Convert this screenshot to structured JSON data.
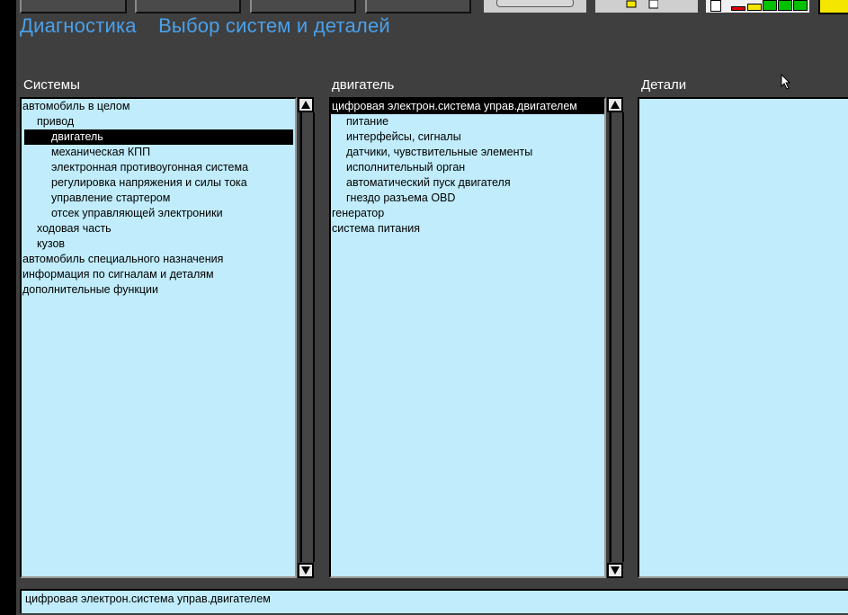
{
  "header": {
    "title_primary": "Диагностика",
    "title_secondary": "Выбор систем и деталей"
  },
  "columns": {
    "systems": {
      "title": "Системы",
      "items": [
        {
          "label": "автомобиль в целом",
          "level": 0,
          "selected": false
        },
        {
          "label": "привод",
          "level": 1,
          "selected": false
        },
        {
          "label": "двигатель",
          "level": 2,
          "selected": true
        },
        {
          "label": "механическая КПП",
          "level": 2,
          "selected": false
        },
        {
          "label": "электронная противоугонная система",
          "level": 2,
          "selected": false
        },
        {
          "label": "регулировка напряжения и силы тока",
          "level": 2,
          "selected": false
        },
        {
          "label": "управление стартером",
          "level": 2,
          "selected": false
        },
        {
          "label": "отсек управляющей электроники",
          "level": 2,
          "selected": false
        },
        {
          "label": "ходовая часть",
          "level": 1,
          "selected": false
        },
        {
          "label": "кузов",
          "level": 1,
          "selected": false
        },
        {
          "label": "автомобиль специального назначения",
          "level": 0,
          "selected": false
        },
        {
          "label": "информация по сигналам и деталям",
          "level": 0,
          "selected": false
        },
        {
          "label": "дополнительные функции",
          "level": 0,
          "selected": false
        }
      ]
    },
    "subsystems": {
      "title": "двигатель",
      "items": [
        {
          "label": "цифровая электрон.система управ.двигателем",
          "level": 0,
          "selected": true
        },
        {
          "label": "питание",
          "level": 1,
          "selected": false
        },
        {
          "label": "интерфейсы, сигналы",
          "level": 1,
          "selected": false
        },
        {
          "label": "датчики, чувствительные элементы",
          "level": 1,
          "selected": false
        },
        {
          "label": "исполнительный орган",
          "level": 1,
          "selected": false
        },
        {
          "label": "автоматический пуск двигателя",
          "level": 1,
          "selected": false
        },
        {
          "label": "гнездо разъема OBD",
          "level": 1,
          "selected": false
        },
        {
          "label": "генератор",
          "level": 0,
          "selected": false
        },
        {
          "label": "система питания",
          "level": 0,
          "selected": false
        }
      ]
    },
    "details": {
      "title": "Детали",
      "items": []
    }
  },
  "status_bar": {
    "text": "цифровая электрон.система управ.двигателем"
  },
  "colors": {
    "background": "#3f3f3f",
    "list_background": "#c0ecfb",
    "title_text": "#4aa0ea",
    "selection": "#000000"
  },
  "icons": {
    "scroll_up": "triangle-up-icon",
    "scroll_down": "triangle-down-icon",
    "signal": "signal-strength-icon",
    "battery": "battery-icon",
    "cursor": "mouse-pointer-icon"
  }
}
